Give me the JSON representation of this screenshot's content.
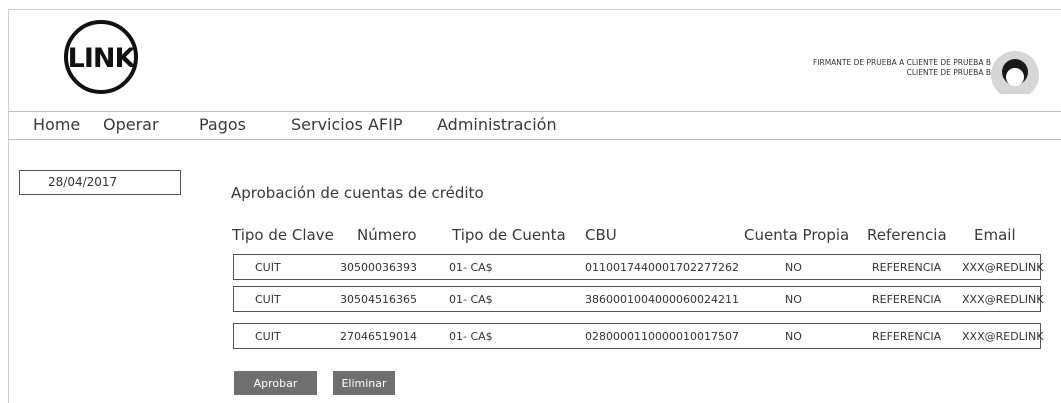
{
  "header": {
    "logo_text": "LINK",
    "user_line1": "FIRMANTE DE PRUEBA A CLIENTE DE PRUEBA B",
    "user_line2": "CLIENTE DE PRUEBA B"
  },
  "nav": {
    "items": [
      "Home",
      "Operar",
      "Pagos",
      "Servicios AFIP",
      "Administración"
    ]
  },
  "date_field": {
    "value": "28/04/2017"
  },
  "section": {
    "title": "Aprobación de cuentas de crédito"
  },
  "table": {
    "headers": [
      "Tipo de Clave",
      "Número",
      "Tipo de Cuenta",
      "CBU",
      "Cuenta Propia",
      "Referencia",
      "Email"
    ],
    "rows": [
      [
        "CUIT",
        "30500036393",
        "01- CA$",
        "0110017440001702277262",
        "NO",
        "REFERENCIA",
        "XXX@REDLINK"
      ],
      [
        "CUIT",
        "30504516365",
        "01- CA$",
        "3860001004000060024211",
        "NO",
        "REFERENCIA",
        "XXX@REDLINK"
      ],
      [
        "CUIT",
        "27046519014",
        "01- CA$",
        "0280000110000010017507",
        "NO",
        "REFERENCIA",
        "XXX@REDLINK"
      ]
    ]
  },
  "actions": {
    "approve_label": "Aprobar",
    "delete_label": "Eliminar"
  },
  "colors": {
    "button_bg": "#6f6f6f",
    "border": "#555555",
    "text": "#333333"
  }
}
